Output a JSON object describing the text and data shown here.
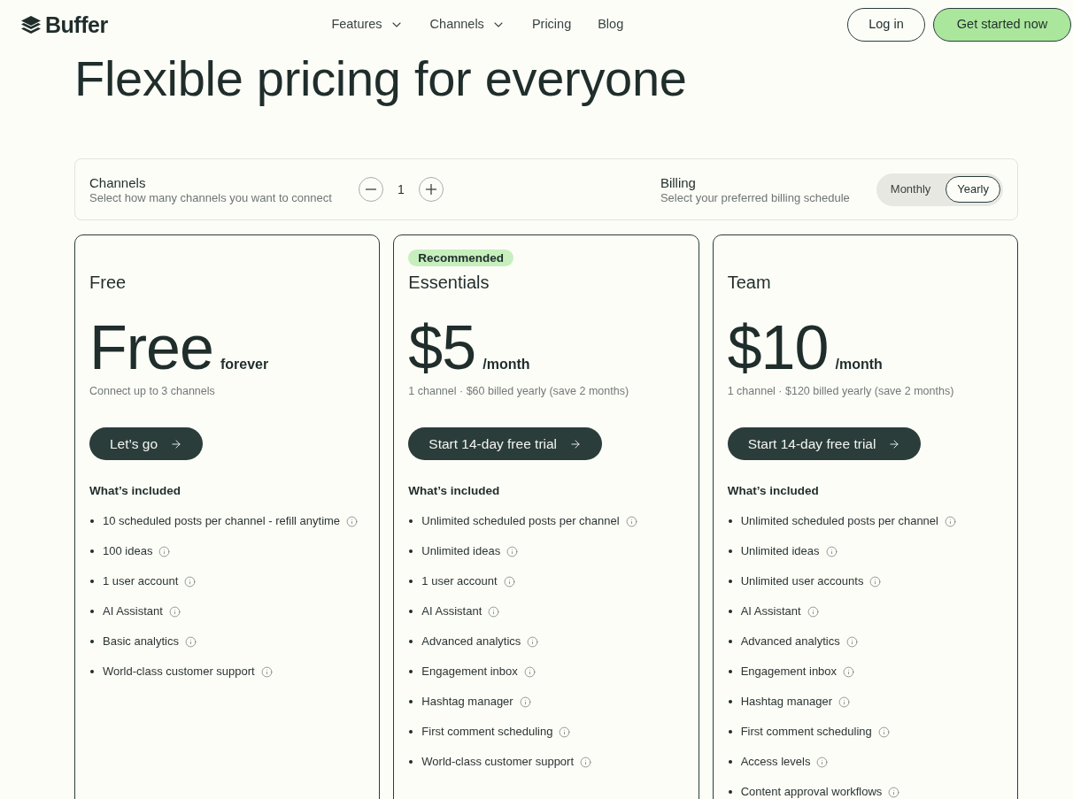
{
  "header": {
    "logo": "Buffer",
    "nav": [
      {
        "label": "Features",
        "dropdown": true
      },
      {
        "label": "Channels",
        "dropdown": true
      },
      {
        "label": "Pricing",
        "dropdown": false
      },
      {
        "label": "Blog",
        "dropdown": false
      }
    ],
    "login": "Log in",
    "cta": "Get started now"
  },
  "heading": "Flexible pricing for everyone",
  "controls": {
    "channels": {
      "title": "Channels",
      "description": "Select how many channels you want to connect",
      "value": "1"
    },
    "billing": {
      "title": "Billing",
      "description": "Select your preferred billing schedule",
      "options": [
        {
          "label": "Monthly",
          "selected": false
        },
        {
          "label": "Yearly",
          "selected": true
        }
      ]
    }
  },
  "plans": [
    {
      "name": "Free",
      "price": "Free",
      "period": "forever",
      "note": "Connect up to 3 channels",
      "button": "Let’s go",
      "included_title": "What’s included",
      "features": [
        "10 scheduled posts per channel - refill anytime",
        "100 ideas",
        "1 user account",
        "AI Assistant",
        "Basic analytics",
        "World-class customer support"
      ]
    },
    {
      "badge": "Recommended",
      "name": "Essentials",
      "price": "$5",
      "period": "/month",
      "note": "1 channel · $60 billed yearly (save 2 months)",
      "button": "Start 14-day free trial",
      "included_title": "What’s included",
      "features": [
        "Unlimited scheduled posts per channel",
        "Unlimited ideas",
        "1 user account",
        "AI Assistant",
        "Advanced analytics",
        "Engagement inbox",
        "Hashtag manager",
        "First comment scheduling",
        "World-class customer support"
      ]
    },
    {
      "name": "Team",
      "price": "$10",
      "period": "/month",
      "note": "1 channel · $120 billed yearly (save 2 months)",
      "button": "Start 14-day free trial",
      "included_title": "What’s included",
      "features": [
        "Unlimited scheduled posts per channel",
        "Unlimited ideas",
        "Unlimited user accounts",
        "AI Assistant",
        "Advanced analytics",
        "Engagement inbox",
        "Hashtag manager",
        "First comment scheduling",
        "Access levels",
        "Content approval workflows"
      ]
    }
  ]
}
